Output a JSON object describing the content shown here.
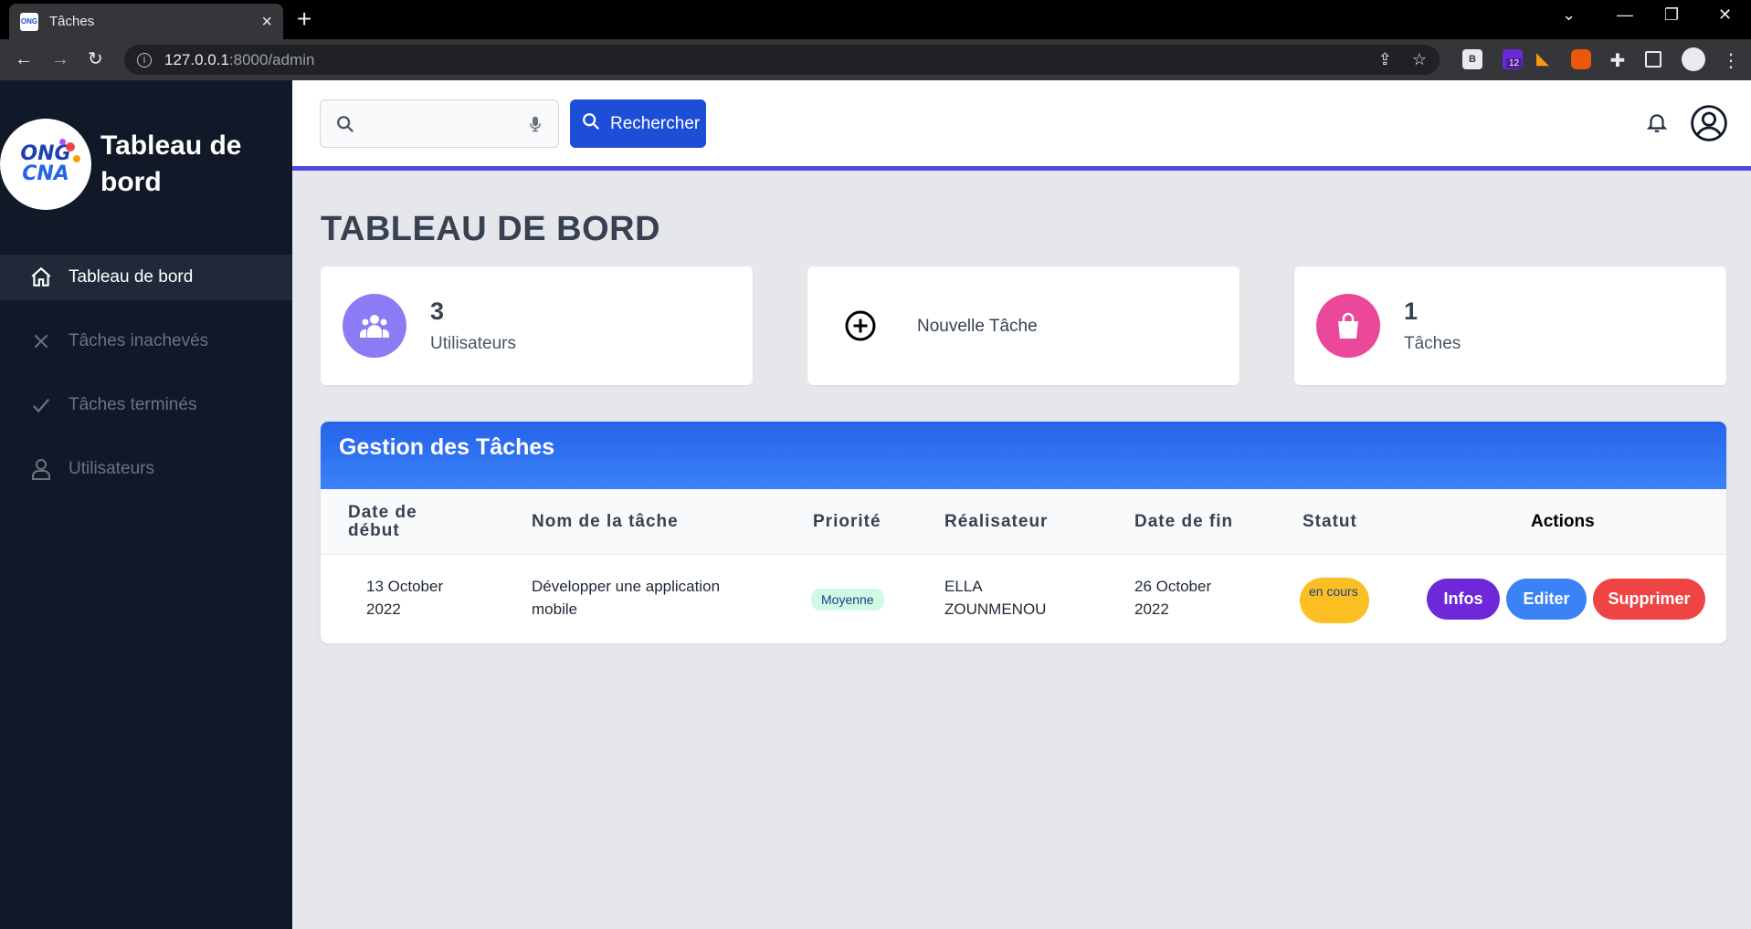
{
  "browser": {
    "tab_title": "Tâches",
    "tab_favicon": "ONG",
    "url_host": "127.0.0.1",
    "url_path": ":8000/admin",
    "extension_badge": "12"
  },
  "sidebar": {
    "logo_text_1": "ONG",
    "logo_text_2": "CNA",
    "brand": "Tableau de bord",
    "items": [
      {
        "label": "Tableau de bord",
        "icon": "home-icon"
      },
      {
        "label": "Tâches inachevés",
        "icon": "close-icon"
      },
      {
        "label": "Tâches terminés",
        "icon": "check-icon"
      },
      {
        "label": "Utilisateurs",
        "icon": "user-icon"
      }
    ]
  },
  "header": {
    "search_placeholder": "",
    "search_button": "Rechercher"
  },
  "main": {
    "title": "TABLEAU DE BORD",
    "cards": [
      {
        "value": "3",
        "label": "Utilisateurs",
        "color": "#8b7cf6"
      },
      {
        "label": "Nouvelle Tâche"
      },
      {
        "value": "1",
        "label": "Tâches",
        "color": "#ec4899"
      }
    ],
    "table": {
      "title": "Gestion des Tâches",
      "columns": [
        "Date de début",
        "Nom de la tâche",
        "Priorité",
        "Réalisateur",
        "Date de fin",
        "Statut",
        "Actions"
      ],
      "rows": [
        {
          "start": "13 October 2022",
          "name": "Développer une application mobile",
          "priority": "Moyenne",
          "assignee": "ELLA ZOUNMENOU",
          "end": "26 October 2022",
          "status": "en cours"
        }
      ],
      "actions": [
        "Infos",
        "Editer",
        "Supprimer"
      ]
    }
  },
  "colors": {
    "accent": "#1d4ed8",
    "sidebar_bg": "#111827",
    "infos": "#6d28d9",
    "editer": "#3b82f6",
    "supprimer": "#ef4444"
  }
}
